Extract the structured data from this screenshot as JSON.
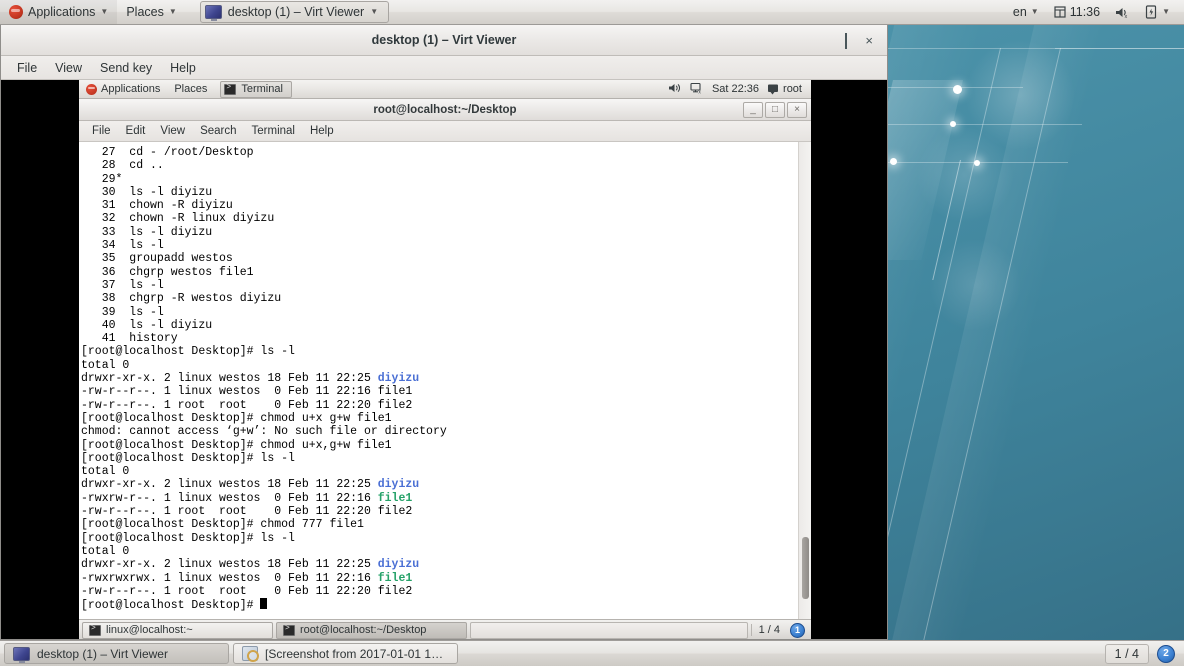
{
  "host_panel": {
    "applications_label": "Applications",
    "places_label": "Places",
    "window_button_label": "desktop (1) – Virt Viewer",
    "tray": {
      "language": "en",
      "clock": "11:36",
      "calendar_icon": "calendar-icon",
      "volume_icon": "volume-muted-icon",
      "power_icon": "battery-icon",
      "caret_icon": "chevron-down-icon"
    }
  },
  "virt_viewer": {
    "title": "desktop (1) – Virt Viewer",
    "menus": [
      "File",
      "View",
      "Send key",
      "Help"
    ],
    "controls": {
      "minimize": "minimize-icon",
      "maximize": "maximize-icon",
      "close": "×"
    }
  },
  "guest_panel": {
    "applications_label": "Applications",
    "places_label": "Places",
    "task_label": "Terminal",
    "tray": {
      "volume_icon": "volume-icon",
      "network_icon": "network-disconnected-icon",
      "clock": "Sat 22:36",
      "user_icon": "user-icon",
      "user": "root"
    }
  },
  "terminal": {
    "title": "root@localhost:~/Desktop",
    "menus": [
      "File",
      "Edit",
      "View",
      "Search",
      "Terminal",
      "Help"
    ],
    "controls": {
      "minimize": "_",
      "maximize": "□",
      "close": "×"
    },
    "lines": [
      [
        {
          "t": "   27  cd - /root/Desktop"
        }
      ],
      [
        {
          "t": "   28  cd .."
        }
      ],
      [
        {
          "t": "   29*"
        }
      ],
      [
        {
          "t": "   30  ls -l diyizu"
        }
      ],
      [
        {
          "t": "   31  chown -R diyizu"
        }
      ],
      [
        {
          "t": "   32  chown -R linux diyizu"
        }
      ],
      [
        {
          "t": "   33  ls -l diyizu"
        }
      ],
      [
        {
          "t": "   34  ls -l"
        }
      ],
      [
        {
          "t": "   35  groupadd westos"
        }
      ],
      [
        {
          "t": "   36  chgrp westos file1"
        }
      ],
      [
        {
          "t": "   37  ls -l"
        }
      ],
      [
        {
          "t": "   38  chgrp -R westos diyizu"
        }
      ],
      [
        {
          "t": "   39  ls -l"
        }
      ],
      [
        {
          "t": "   40  ls -l diyizu"
        }
      ],
      [
        {
          "t": "   41  history"
        }
      ],
      [
        {
          "t": "[root@localhost Desktop]# ls -l"
        }
      ],
      [
        {
          "t": "total 0"
        }
      ],
      [
        {
          "t": "drwxr-xr-x. 2 linux westos 18 Feb 11 22:25 "
        },
        {
          "t": "diyizu",
          "c": "c-blue"
        }
      ],
      [
        {
          "t": "-rw-r--r--. 1 linux westos  0 Feb 11 22:16 file1"
        }
      ],
      [
        {
          "t": "-rw-r--r--. 1 root  root    0 Feb 11 22:20 file2"
        }
      ],
      [
        {
          "t": "[root@localhost Desktop]# chmod u+x g+w file1"
        }
      ],
      [
        {
          "t": "chmod: cannot access ‘g+w’: No such file or directory"
        }
      ],
      [
        {
          "t": "[root@localhost Desktop]# chmod u+x,g+w file1"
        }
      ],
      [
        {
          "t": "[root@localhost Desktop]# ls -l"
        }
      ],
      [
        {
          "t": "total 0"
        }
      ],
      [
        {
          "t": "drwxr-xr-x. 2 linux westos 18 Feb 11 22:25 "
        },
        {
          "t": "diyizu",
          "c": "c-blue"
        }
      ],
      [
        {
          "t": "-rwxrw-r--. 1 linux westos  0 Feb 11 22:16 "
        },
        {
          "t": "file1",
          "c": "c-green"
        }
      ],
      [
        {
          "t": "-rw-r--r--. 1 root  root    0 Feb 11 22:20 file2"
        }
      ],
      [
        {
          "t": "[root@localhost Desktop]# chmod 777 file1"
        }
      ],
      [
        {
          "t": "[root@localhost Desktop]# ls -l"
        }
      ],
      [
        {
          "t": "total 0"
        }
      ],
      [
        {
          "t": "drwxr-xr-x. 2 linux westos 18 Feb 11 22:25 "
        },
        {
          "t": "diyizu",
          "c": "c-blue"
        }
      ],
      [
        {
          "t": "-rwxrwxrwx. 1 linux westos  0 Feb 11 22:16 "
        },
        {
          "t": "file1",
          "c": "c-green"
        }
      ],
      [
        {
          "t": "-rw-r--r--. 1 root  root    0 Feb 11 22:20 file2"
        }
      ],
      [
        {
          "t": "[root@localhost Desktop]# ",
          "cursor": true
        }
      ]
    ]
  },
  "guest_taskbar": {
    "items": [
      {
        "label": "linux@localhost:~",
        "active": false
      },
      {
        "label": "root@localhost:~/Desktop",
        "active": true
      }
    ],
    "workspace": "1 / 4",
    "badge": "1"
  },
  "host_taskbar": {
    "items": [
      {
        "label": "desktop (1) – Virt Viewer",
        "active": true,
        "icon": "monitor-icon"
      },
      {
        "label": "[Screenshot from 2017-01-01 1…",
        "active": false,
        "icon": "screenshot-icon"
      }
    ],
    "workspace": "1 / 4",
    "badge": "2"
  },
  "colors": {
    "terminal_dir_blue": "#4a6fd4",
    "terminal_exec_green": "#26a269",
    "wallpaper_teal": "#4a91a8",
    "badge_blue": "#3a7fd0"
  }
}
